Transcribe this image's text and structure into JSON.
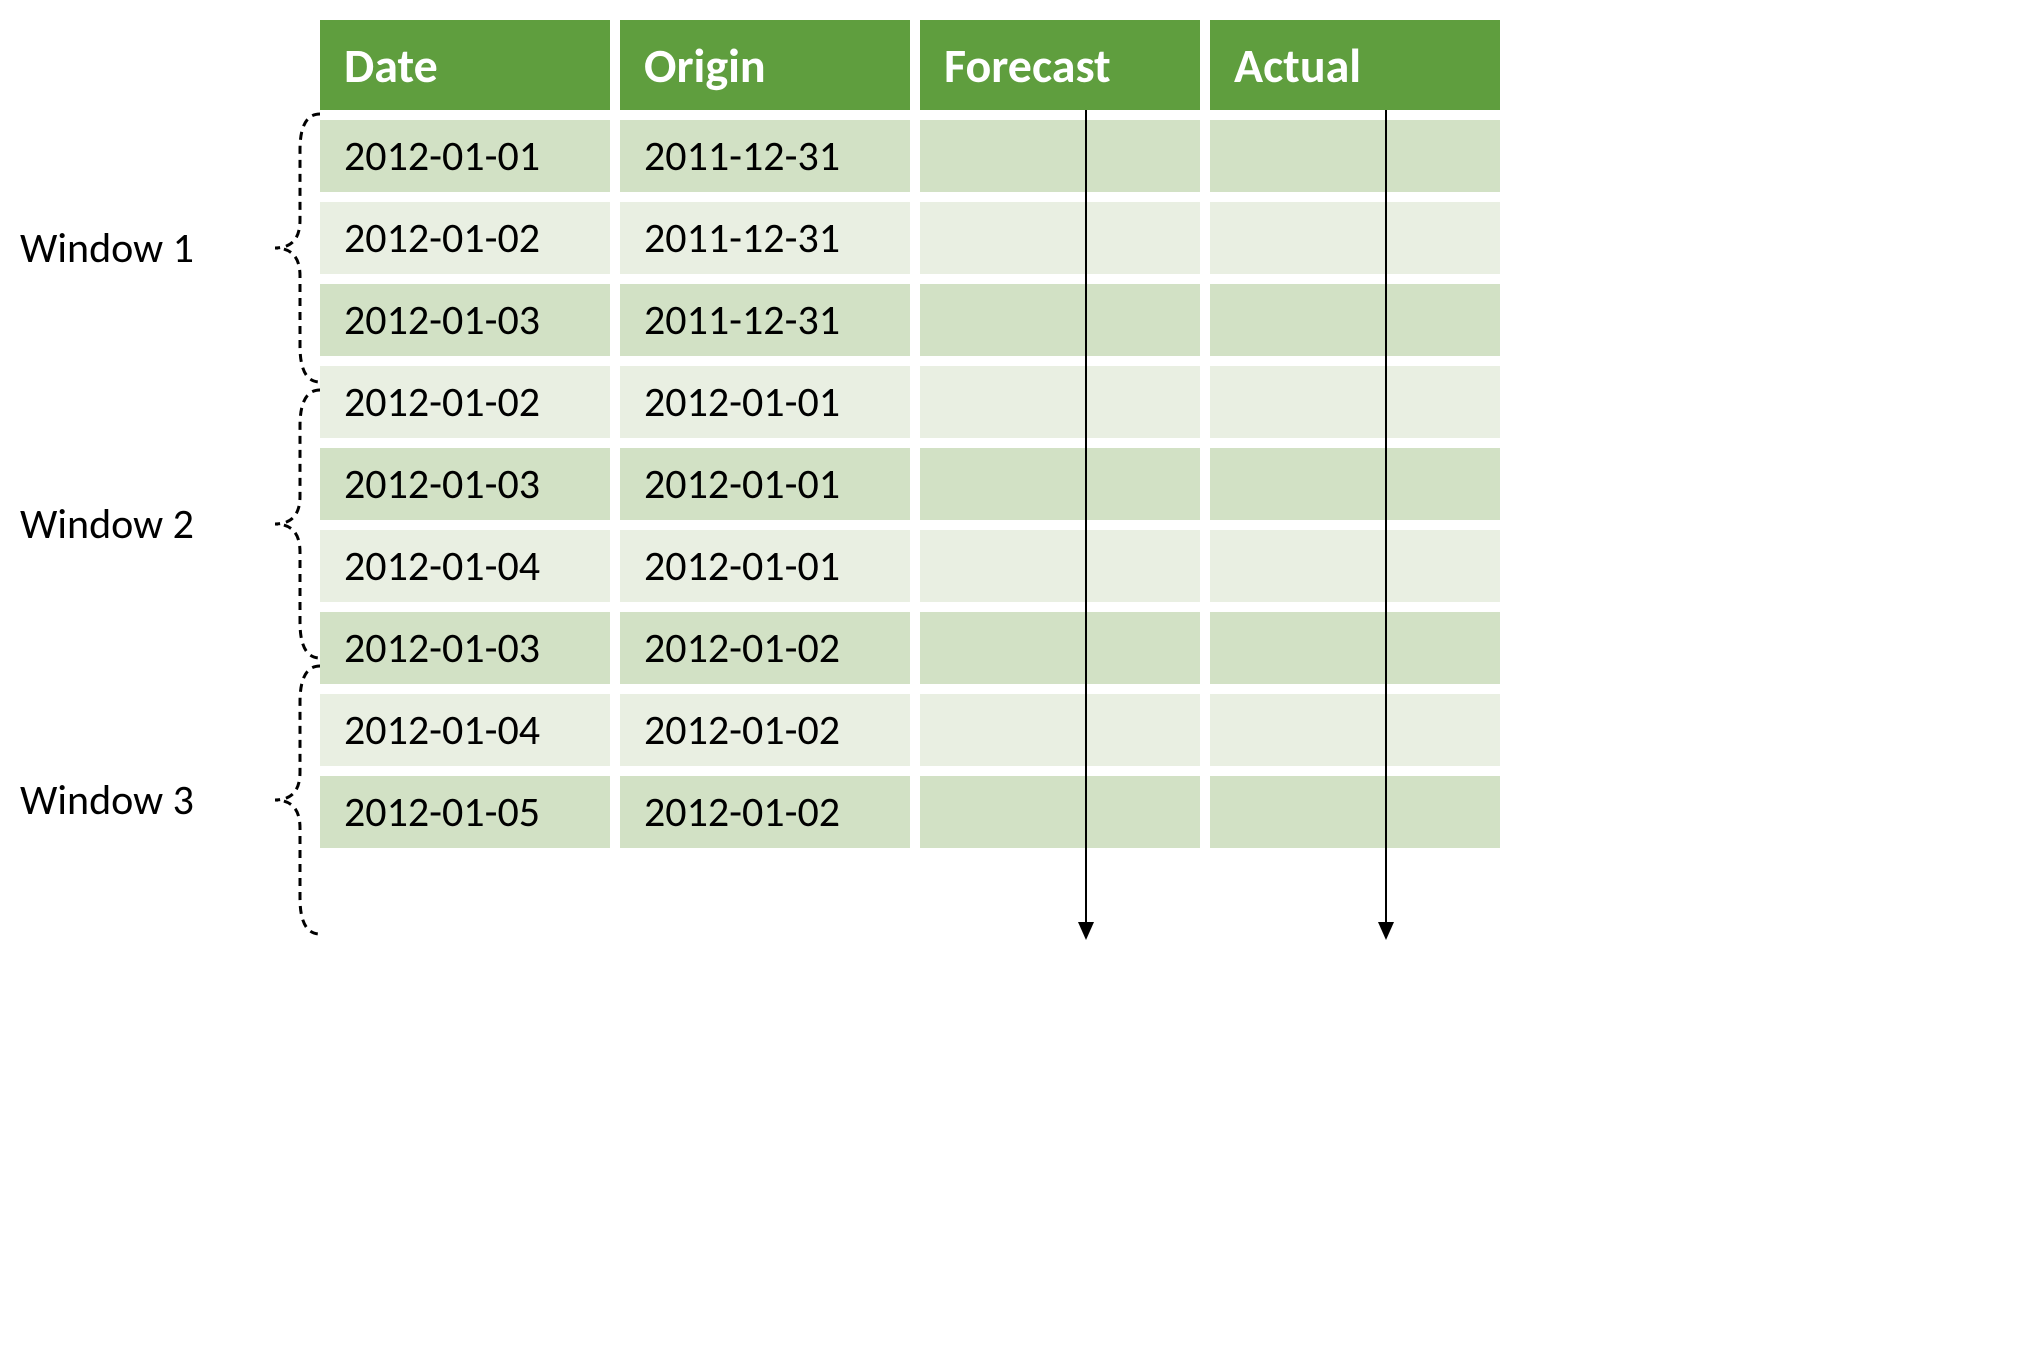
{
  "headers": {
    "date": "Date",
    "origin": "Origin",
    "forecast": "Forecast",
    "actual": "Actual"
  },
  "windows": [
    {
      "label": "Window 1"
    },
    {
      "label": "Window 2"
    },
    {
      "label": "Window 3"
    }
  ],
  "rows": [
    {
      "date": "2012-01-01",
      "origin": "2011-12-31",
      "forecast": "",
      "actual": ""
    },
    {
      "date": "2012-01-02",
      "origin": "2011-12-31",
      "forecast": "",
      "actual": ""
    },
    {
      "date": "2012-01-03",
      "origin": "2011-12-31",
      "forecast": "",
      "actual": ""
    },
    {
      "date": "2012-01-02",
      "origin": "2012-01-01",
      "forecast": "",
      "actual": ""
    },
    {
      "date": "2012-01-03",
      "origin": "2012-01-01",
      "forecast": "",
      "actual": ""
    },
    {
      "date": "2012-01-04",
      "origin": "2012-01-01",
      "forecast": "",
      "actual": ""
    },
    {
      "date": "2012-01-03",
      "origin": "2012-01-02",
      "forecast": "",
      "actual": ""
    },
    {
      "date": "2012-01-04",
      "origin": "2012-01-02",
      "forecast": "",
      "actual": ""
    },
    {
      "date": "2012-01-05",
      "origin": "2012-01-02",
      "forecast": "",
      "actual": ""
    }
  ]
}
